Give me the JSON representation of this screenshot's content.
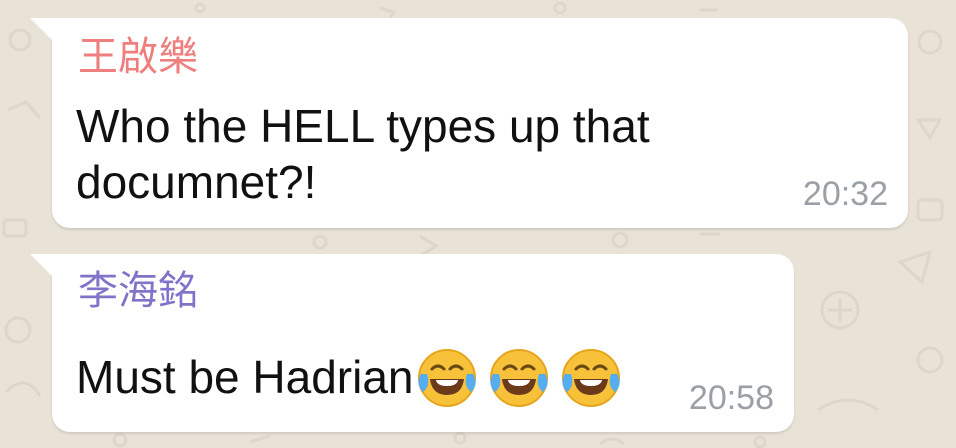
{
  "chat": {
    "messages": [
      {
        "sender": "王啟樂",
        "text": "Who the HELL types up that documnet?!",
        "time": "20:32",
        "sender_color": "#ef7f7f"
      },
      {
        "sender": "李海銘",
        "text": "Must be Hadrian",
        "emoji": [
          "face-with-tears-of-joy",
          "face-with-tears-of-joy",
          "face-with-tears-of-joy"
        ],
        "time": "20:58",
        "sender_color": "#8272c9"
      }
    ]
  },
  "colors": {
    "wallpaper": "#e9e2d7",
    "bubble": "#ffffff",
    "timestamp": "#9aa0a6"
  }
}
